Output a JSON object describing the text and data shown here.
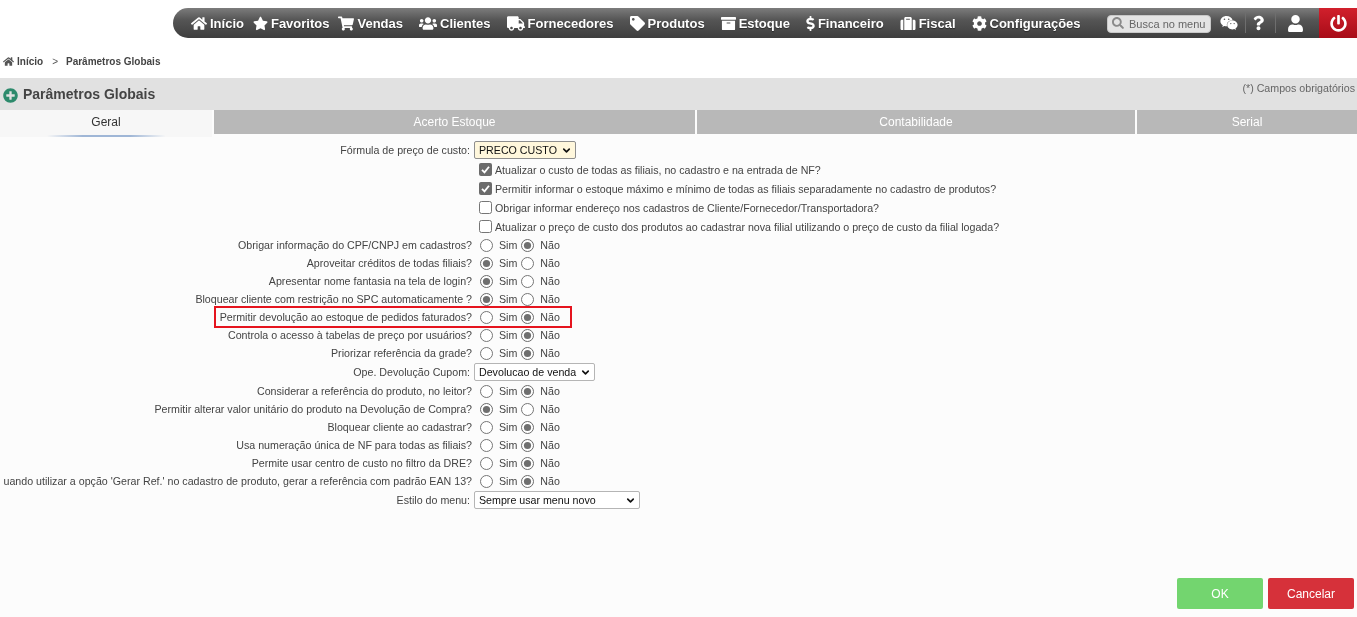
{
  "nav": {
    "items": [
      {
        "label": "Início"
      },
      {
        "label": "Favoritos"
      },
      {
        "label": "Vendas"
      },
      {
        "label": "Clientes"
      },
      {
        "label": "Fornecedores"
      },
      {
        "label": "Produtos"
      },
      {
        "label": "Estoque"
      },
      {
        "label": "Financeiro"
      },
      {
        "label": "Fiscal"
      },
      {
        "label": "Configurações"
      }
    ],
    "search": {
      "placeholder": "Busca no menu"
    }
  },
  "breadcrumb": {
    "items": [
      "Início",
      "Parâmetros Globais"
    ],
    "separator": ">"
  },
  "header": {
    "title": "Parâmetros Globais",
    "note": "(*) Campos obrigatórios"
  },
  "tabs": [
    {
      "label": "Geral",
      "selected": true
    },
    {
      "label": "Acerto Estoque",
      "selected": false
    },
    {
      "label": "Contabilidade",
      "selected": false
    },
    {
      "label": "Serial",
      "selected": false
    }
  ],
  "form": {
    "rows": [
      {
        "kind": "select",
        "label": "Fórmula de preço de custo:",
        "value": "PRECO CUSTO",
        "focused": true,
        "highlighted": false
      },
      {
        "kind": "checkbox",
        "text": "Atualizar o custo de todas as filiais, no cadastro e na entrada de NF?",
        "checked": true,
        "highlighted": false
      },
      {
        "kind": "checkbox",
        "text": "Permitir informar o estoque máximo e mínimo de todas as filiais separadamente no cadastro de produtos?",
        "checked": true,
        "highlighted": false
      },
      {
        "kind": "checkbox",
        "text": "Obrigar informar endereço nos cadastros de Cliente/Fornecedor/Transportadora?",
        "checked": false,
        "highlighted": false
      },
      {
        "kind": "checkbox",
        "text": "Atualizar o preço de custo dos produtos ao cadastrar nova filial utilizando o preço de custo da filial logada?",
        "checked": false,
        "highlighted": false
      },
      {
        "kind": "radio",
        "label": "Obrigar informação do CPF/CNPJ em cadastros?",
        "options": [
          {
            "label": "Sim",
            "selected": false
          },
          {
            "label": "Não",
            "selected": true
          }
        ],
        "highlighted": false
      },
      {
        "kind": "radio",
        "label": "Aproveitar créditos de todas filiais?",
        "options": [
          {
            "label": "Sim",
            "selected": true
          },
          {
            "label": "Não",
            "selected": false
          }
        ],
        "highlighted": false
      },
      {
        "kind": "radio",
        "label": "Apresentar nome fantasia na tela de login?",
        "options": [
          {
            "label": "Sim",
            "selected": true
          },
          {
            "label": "Não",
            "selected": false
          }
        ],
        "highlighted": false
      },
      {
        "kind": "radio",
        "label": "Bloquear cliente com restrição no SPC automaticamente ?",
        "options": [
          {
            "label": "Sim",
            "selected": true
          },
          {
            "label": "Não",
            "selected": false
          }
        ],
        "highlighted": false
      },
      {
        "kind": "radio",
        "label": "Permitir devolução ao estoque de pedidos faturados?",
        "options": [
          {
            "label": "Sim",
            "selected": false
          },
          {
            "label": "Não",
            "selected": true
          }
        ],
        "highlighted": true
      },
      {
        "kind": "radio",
        "label": "Controla o acesso à tabelas de preço por usuários?",
        "options": [
          {
            "label": "Sim",
            "selected": false
          },
          {
            "label": "Não",
            "selected": true
          }
        ],
        "highlighted": false
      },
      {
        "kind": "radio",
        "label": "Priorizar referência da grade?",
        "options": [
          {
            "label": "Sim",
            "selected": false
          },
          {
            "label": "Não",
            "selected": true
          }
        ],
        "highlighted": false
      },
      {
        "kind": "select",
        "label": "Ope. Devolução Cupom:",
        "value": "Devolucao de venda",
        "focused": false,
        "highlighted": false
      },
      {
        "kind": "radio",
        "label": "Considerar a referência do produto, no leitor?",
        "options": [
          {
            "label": "Sim",
            "selected": false
          },
          {
            "label": "Não",
            "selected": true
          }
        ],
        "highlighted": false
      },
      {
        "kind": "radio",
        "label": "Permitir alterar valor unitário do produto na Devolução de Compra?",
        "options": [
          {
            "label": "Sim",
            "selected": true
          },
          {
            "label": "Não",
            "selected": false
          }
        ],
        "highlighted": false
      },
      {
        "kind": "radio",
        "label": "Bloquear cliente ao cadastrar?",
        "options": [
          {
            "label": "Sim",
            "selected": false
          },
          {
            "label": "Não",
            "selected": true
          }
        ],
        "highlighted": false
      },
      {
        "kind": "radio",
        "label": "Usa numeração única de NF para todas as filiais?",
        "options": [
          {
            "label": "Sim",
            "selected": false
          },
          {
            "label": "Não",
            "selected": true
          }
        ],
        "highlighted": false
      },
      {
        "kind": "radio",
        "label": "Permite usar centro de custo no filtro da DRE?",
        "options": [
          {
            "label": "Sim",
            "selected": false
          },
          {
            "label": "Não",
            "selected": true
          }
        ],
        "highlighted": false
      },
      {
        "kind": "radio",
        "label": "uando utilizar a opção 'Gerar Ref.' no cadastro de produto, gerar a referência com padrão EAN 13?",
        "options": [
          {
            "label": "Sim",
            "selected": false
          },
          {
            "label": "Não",
            "selected": true
          }
        ],
        "highlighted": false
      },
      {
        "kind": "select",
        "label": "Estilo do menu:",
        "value": "Sempre usar menu novo",
        "focused": false,
        "highlighted": false
      }
    ]
  },
  "buttons": [
    {
      "label": "OK",
      "kind": "confirm"
    },
    {
      "label": "Cancelar",
      "kind": "cancel"
    }
  ]
}
